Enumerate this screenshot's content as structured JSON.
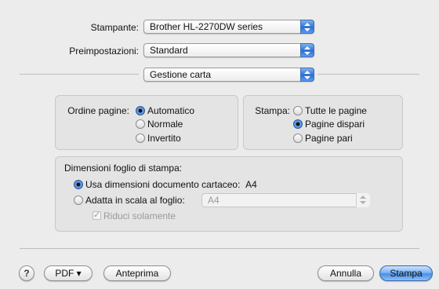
{
  "printer": {
    "label": "Stampante:",
    "value": "Brother HL-2270DW series"
  },
  "presets": {
    "label": "Preimpostazioni:",
    "value": "Standard"
  },
  "panel": {
    "value": "Gestione carta"
  },
  "page_order": {
    "label": "Ordine pagine:",
    "options": [
      "Automatico",
      "Normale",
      "Invertito"
    ],
    "selected": "Automatico"
  },
  "print_pages": {
    "label": "Stampa:",
    "options": [
      "Tutte le pagine",
      "Pagine dispari",
      "Pagine pari"
    ],
    "selected": "Pagine dispari"
  },
  "paper_size": {
    "title": "Dimensioni foglio di stampa:",
    "use_document_label": "Usa dimensioni documento cartaceo:",
    "use_document_value": "A4",
    "scale_label": "Adatta in scala al foglio:",
    "scale_value": "A4",
    "scale_down_only_label": "Riduci solamente",
    "scale_down_only_checked": true
  },
  "footer": {
    "help": "?",
    "pdf_label": "PDF ▾",
    "preview_label": "Anteprima",
    "cancel_label": "Annulla",
    "print_label": "Stampa"
  }
}
